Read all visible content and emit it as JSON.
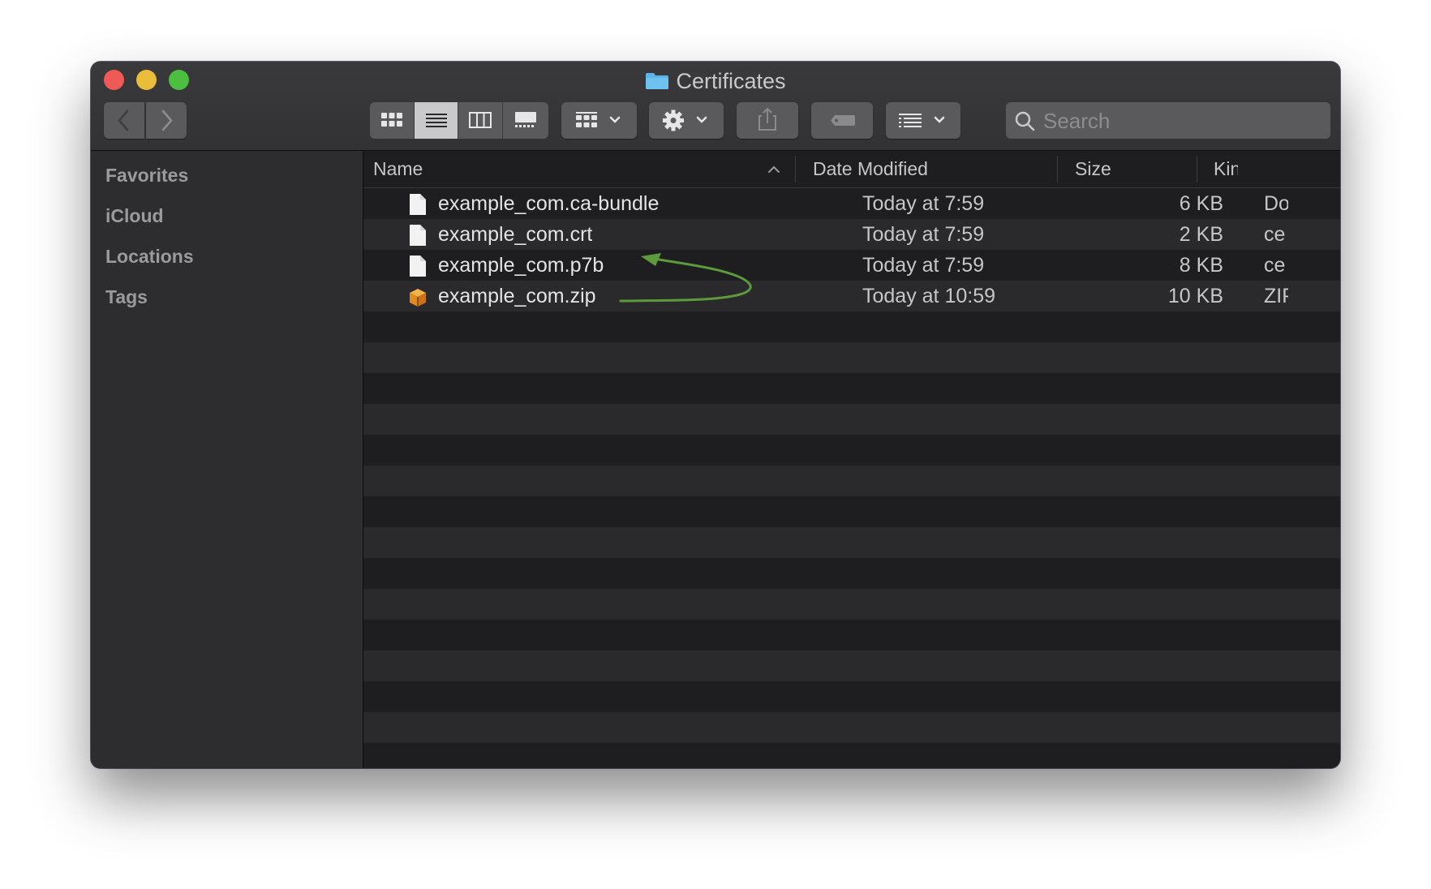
{
  "window": {
    "title": "Certificates"
  },
  "toolbar": {
    "buttons": [
      {
        "name": "back",
        "icon": "chevron-left-icon"
      },
      {
        "name": "forward",
        "icon": "chevron-right-icon"
      },
      {
        "name": "icon-view",
        "icon": "grid-icon"
      },
      {
        "name": "list-view",
        "icon": "list-icon",
        "active": true
      },
      {
        "name": "column-view",
        "icon": "columns-icon"
      },
      {
        "name": "gallery-view",
        "icon": "gallery-icon"
      },
      {
        "name": "group",
        "icon": "group-grid-icon"
      },
      {
        "name": "action",
        "icon": "gear-icon"
      },
      {
        "name": "share",
        "icon": "share-icon"
      },
      {
        "name": "tags",
        "icon": "tag-icon"
      },
      {
        "name": "arrange",
        "icon": "arrange-icon"
      }
    ],
    "search_placeholder": "Search"
  },
  "sidebar": {
    "sections": [
      "Favorites",
      "iCloud",
      "Locations",
      "Tags"
    ]
  },
  "columns": {
    "name": "Name",
    "date": "Date Modified",
    "size": "Size",
    "kind": "Kin"
  },
  "files": [
    {
      "name": "example_com.ca-bundle",
      "date": "Today at 7:59",
      "size": "6 KB",
      "kind": "Do",
      "icon": "document-icon"
    },
    {
      "name": "example_com.crt",
      "date": "Today at 7:59",
      "size": "2 KB",
      "kind": "ce",
      "icon": "document-icon"
    },
    {
      "name": "example_com.p7b",
      "date": "Today at 7:59",
      "size": "8 KB",
      "kind": "ce",
      "icon": "document-icon"
    },
    {
      "name": "example_com.zip",
      "date": "Today at 10:59",
      "size": "10 KB",
      "kind": "ZIP",
      "icon": "zip-archive-icon"
    }
  ],
  "colors": {
    "window_bg": "#1e1e20",
    "sidebar_bg": "#2d2d2f",
    "toolbar_button": "#5a5a5c",
    "annotation_arrow": "#5d9a3b",
    "close": "#ee5b56",
    "minimize": "#e9bc3a",
    "maximize": "#4cbf41"
  }
}
